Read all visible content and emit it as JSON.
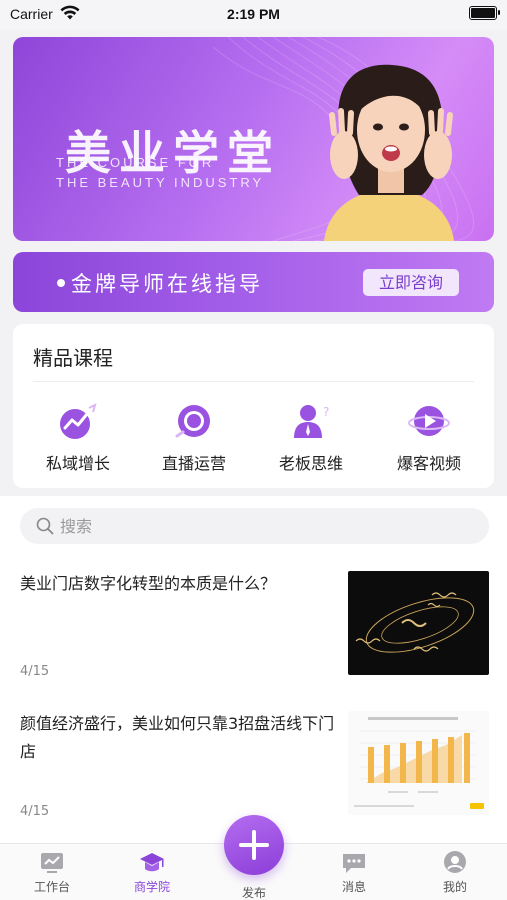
{
  "status_bar": {
    "carrier": "Carrier",
    "time": "2:19 PM"
  },
  "banner": {
    "title": "美业学堂",
    "subtitle_line1": "THE COURSE FOR",
    "subtitle_line2": "THE BEAUTY INDUSTRY"
  },
  "consult": {
    "text": "金牌导师在线指导",
    "button": "立即咨询"
  },
  "courses": {
    "title": "精品课程",
    "items": [
      {
        "label": "私域增长",
        "icon": "growth-icon"
      },
      {
        "label": "直播运营",
        "icon": "live-icon"
      },
      {
        "label": "老板思维",
        "icon": "boss-icon"
      },
      {
        "label": "爆客视频",
        "icon": "video-icon"
      }
    ]
  },
  "search": {
    "placeholder": "搜索"
  },
  "articles": [
    {
      "title": "美业门店数字化转型的本质是什么？",
      "date": "4/15",
      "thumb": "chalkboard-image"
    },
    {
      "title": "颜值经济盛行，美业如何只靠3招盘活线下门店",
      "date": "4/15",
      "thumb": "bar-chart-image"
    }
  ],
  "tab_bar": {
    "items": [
      {
        "label": "工作台",
        "active": false
      },
      {
        "label": "商学院",
        "active": true
      },
      {
        "label": "发布",
        "active": false
      },
      {
        "label": "消息",
        "active": false
      },
      {
        "label": "我的",
        "active": false
      }
    ]
  },
  "colors": {
    "accent": "#8b45d9",
    "banner_light": "#d58cf7"
  }
}
